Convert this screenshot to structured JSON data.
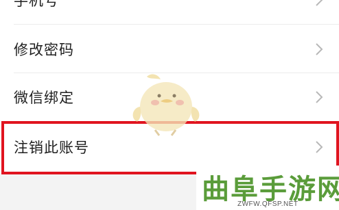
{
  "menu": {
    "items": [
      {
        "label": "手机号"
      },
      {
        "label": "修改密码"
      },
      {
        "label": "微信绑定"
      },
      {
        "label": "注销此账号"
      }
    ]
  },
  "watermark": {
    "brand": "曲阜手游网",
    "url": "ZWFW.QFSP.NET"
  },
  "colors": {
    "highlight": "#e0141f",
    "text": "#1f1f1f",
    "chevron": "#b8b8b8",
    "brand": "#5a9c3a"
  },
  "icons": {
    "chevron": "chevron-right-icon",
    "mascot": "chick-mascot-icon"
  }
}
